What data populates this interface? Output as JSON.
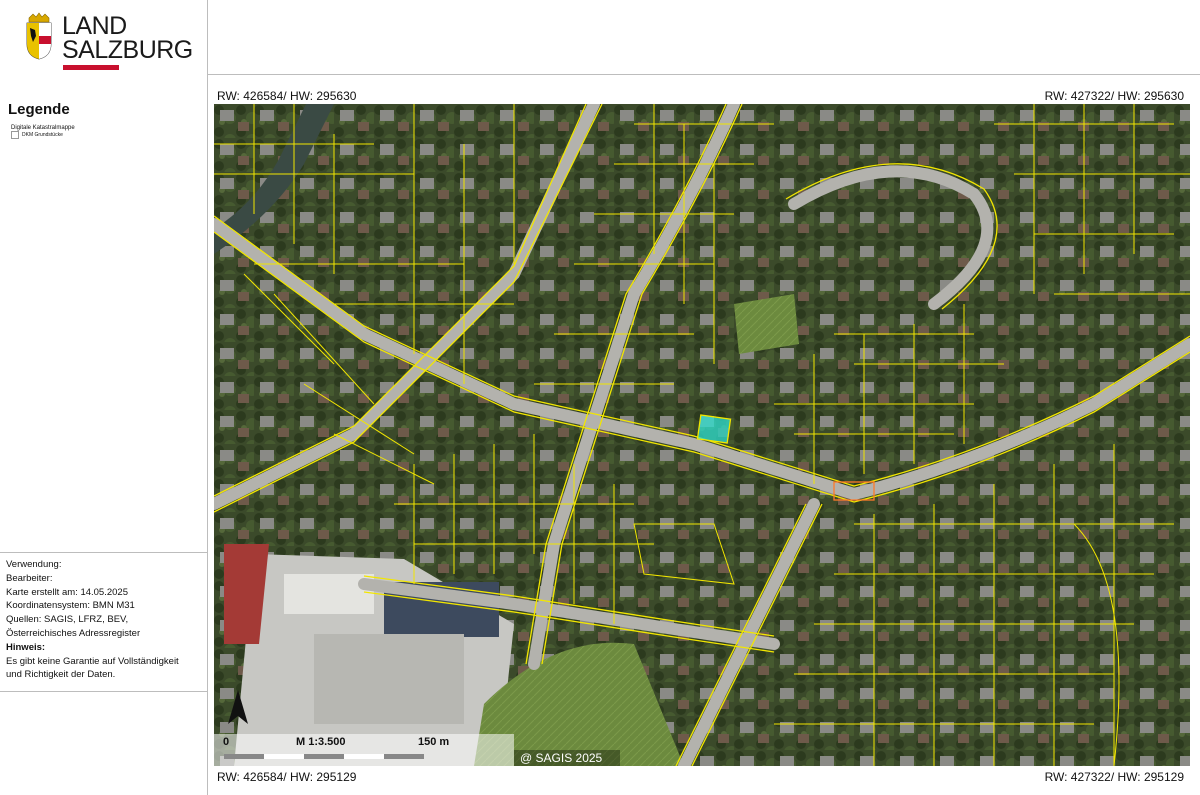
{
  "logo": {
    "line1": "LAND",
    "line2": "SALZBURG",
    "accent_color": "#c8102e"
  },
  "legend": {
    "title": "Legende",
    "layer_name": "Digitale Katastralmappe",
    "item_label": "DKM Grundstücke"
  },
  "info": {
    "verwendung": "Verwendung:",
    "bearbeiter": "Bearbeiter:",
    "erstellt": "Karte erstellt am: 14.05.2025",
    "koordinatensystem": "Koordinatensystem: BMN M31",
    "quellen": "Quellen: SAGIS, LFRZ, BEV,",
    "quellen2": "Österreichisches Adressregister",
    "hinweis_title": "Hinweis:",
    "hinweis_text1": "Es gibt keine Garantie auf Vollständigkeit",
    "hinweis_text2": "und Richtigkeit der Daten."
  },
  "coords": {
    "top_left": "RW: 426584/ HW: 295630",
    "top_right": "RW: 427322/ HW: 295630",
    "bottom_left": "RW: 426584/ HW: 295129",
    "bottom_right": "RW: 427322/ HW: 295129"
  },
  "scale": {
    "start": "0",
    "ratio": "M 1:3.500",
    "end": "150 m"
  },
  "copyright": "@ SAGIS 2025",
  "map": {
    "parcel_line_color": "#f2e600",
    "highlight_parcel_color": "#2ee0d0",
    "icon": "north-arrow-icon"
  }
}
